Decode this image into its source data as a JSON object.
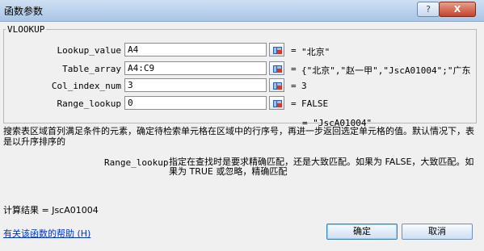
{
  "window": {
    "title": "函数参数",
    "help_glyph": "?",
    "close_glyph": "X"
  },
  "function_name": "VLOOKUP",
  "args": [
    {
      "label": "Lookup_value",
      "value": "A4",
      "result": "\"北京\""
    },
    {
      "label": "Table_array",
      "value": "A4:C9",
      "result": "{\"北京\",\"赵一甲\",\"JscA01004\";\"广东"
    },
    {
      "label": "Col_index_num",
      "value": "3",
      "result": "3"
    },
    {
      "label": "Range_lookup",
      "value": "0",
      "result": "FALSE"
    }
  ],
  "equals": "=",
  "formula_result": "= \"JscA01004\"",
  "description": "搜索表区域首列满足条件的元素，确定待检索单元格在区域中的行序号，再进一步返回选定单元格的值。默认情况下，表是以升序排序的",
  "selected_arg": {
    "name": "Range_lookup",
    "description": "指定在查找时是要求精确匹配，还是大致匹配。如果为 FALSE，大致匹配。如果为 TRUE 或忽略，精确匹配"
  },
  "calc_result": "计算结果 =  JscA01004",
  "help_link": "有关该函数的帮助 (H)",
  "buttons": {
    "ok": "确定",
    "cancel": "取消"
  }
}
